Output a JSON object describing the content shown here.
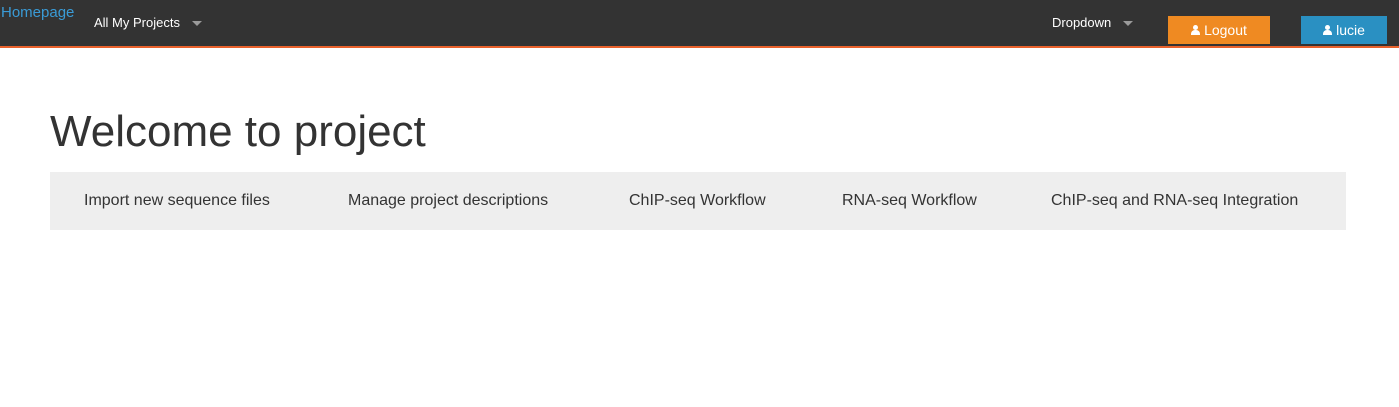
{
  "navbar": {
    "brand": "Homepage",
    "projects_dropdown": "All My Projects",
    "dropdown": "Dropdown",
    "logout_label": "Logout",
    "user_label": "lucie"
  },
  "main": {
    "title": "Welcome to project",
    "tabs": [
      {
        "label": "Import new sequence files"
      },
      {
        "label": "Manage project descriptions"
      },
      {
        "label": "ChIP-seq Workflow"
      },
      {
        "label": "RNA-seq Workflow"
      },
      {
        "label": "ChIP-seq and RNA-seq Integration"
      }
    ]
  },
  "colors": {
    "navbar_bg": "#333333",
    "navbar_border": "#e8612c",
    "brand": "#3a9bd6",
    "logout_button": "#ef8a22",
    "user_button": "#2a90c2",
    "tabs_bg": "#eeeeee"
  },
  "icons": {
    "logout_icon": "user-icon",
    "user_icon": "user-icon",
    "dropdown_icon": "caret-down-icon"
  }
}
